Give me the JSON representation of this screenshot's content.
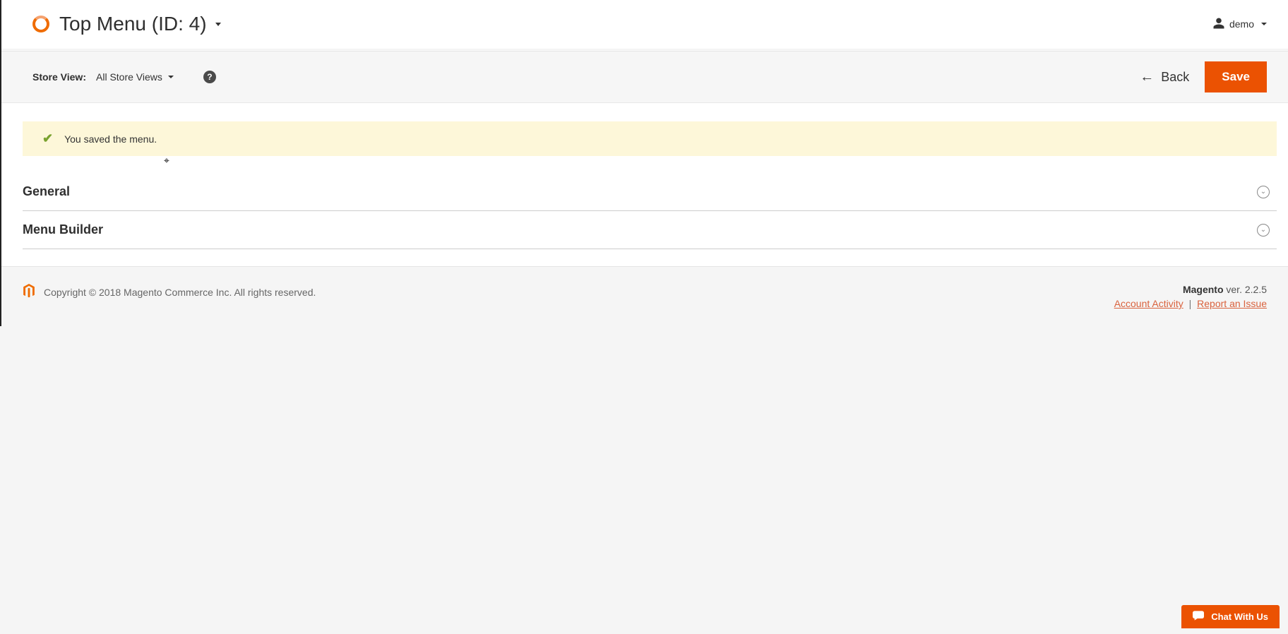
{
  "header": {
    "title": "Top Menu (ID: 4)",
    "user": "demo"
  },
  "toolbar": {
    "store_view_label": "Store View:",
    "store_view_value": "All Store Views",
    "help_symbol": "?",
    "back_label": "Back",
    "save_label": "Save"
  },
  "messages": {
    "success": "You saved the menu."
  },
  "sections": [
    {
      "title": "General"
    },
    {
      "title": "Menu Builder"
    }
  ],
  "footer": {
    "copyright": "Copyright © 2018 Magento Commerce Inc. All rights reserved.",
    "brand": "Magento",
    "version_prefix": " ver. ",
    "version": "2.2.5",
    "account_activity": "Account Activity",
    "report_issue": "Report an Issue"
  },
  "chat": {
    "label": "Chat With Us"
  }
}
